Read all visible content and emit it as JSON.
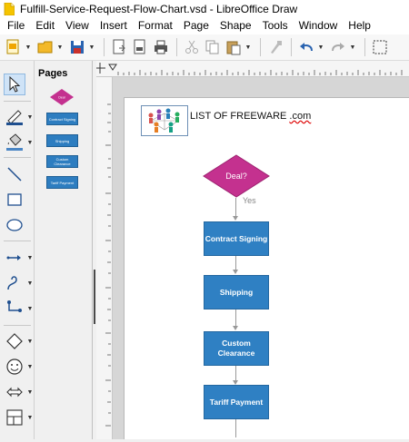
{
  "window": {
    "title": "Fulfill-Service-Request-Flow-Chart.vsd - LibreOffice Draw"
  },
  "menu": [
    "File",
    "Edit",
    "View",
    "Insert",
    "Format",
    "Page",
    "Shape",
    "Tools",
    "Window",
    "Help"
  ],
  "pages_panel": {
    "title": "Pages",
    "thumbs": [
      "Deal",
      "Contract Signing",
      "Shipping",
      "Custom Clearance",
      "Tariff Payment"
    ]
  },
  "document": {
    "logo_text": "LIST OF FREEWARE",
    "logo_suffix": ".com",
    "decision_label": "Deal?",
    "yes_label": "Yes",
    "steps": [
      "Contract Signing",
      "Shipping",
      "Custom Clearance",
      "Tariff Payment"
    ]
  },
  "colors": {
    "decision": "#c4318f",
    "process": "#2f80c3",
    "connector": "#999999"
  },
  "icons": {
    "toolbar": [
      "new-document-icon",
      "open-folder-icon",
      "save-icon",
      "export-icon",
      "export-pdf-icon",
      "print-icon",
      "cut-icon",
      "copy-icon",
      "paste-icon",
      "clone-formatting-icon",
      "undo-icon",
      "redo-icon",
      "grid-icon"
    ],
    "left_toolbar": [
      "select-arrow-icon",
      "line-color-icon",
      "fill-color-icon",
      "line-icon",
      "rectangle-icon",
      "ellipse-icon",
      "arrow-line-icon",
      "curve-icon",
      "connector-icon",
      "basic-shapes-icon",
      "symbol-shapes-icon",
      "block-arrows-icon",
      "flowchart-icon"
    ]
  }
}
